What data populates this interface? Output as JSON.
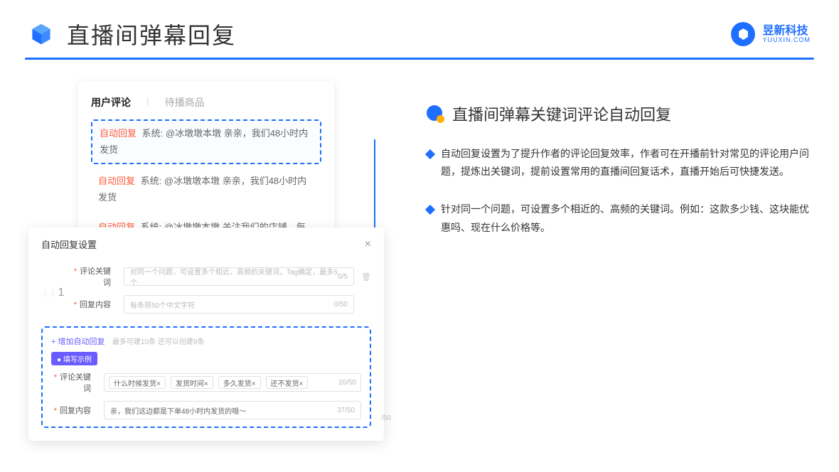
{
  "header": {
    "title": "直播间弹幕回复",
    "brand_name": "昱新科技",
    "brand_sub": "YUUXIN.COM"
  },
  "comments": {
    "tab_active": "用户评论",
    "tab_inactive": "待播商品",
    "rows": [
      {
        "tag": "自动回复",
        "sys": "系统:",
        "text": "@冰墩墩本墩 亲亲，我们48小时内发货"
      },
      {
        "tag": "自动回复",
        "sys": "系统:",
        "text": "@冰墩墩本墩 亲亲，我们48小时内发货"
      },
      {
        "tag": "自动回复",
        "sys": "系统:",
        "text": "@冰墩墩本墩 关注我们的店铺，每日都有热门推荐哟～"
      }
    ]
  },
  "settings": {
    "title": "自动回复设置",
    "index": "1",
    "kw_label": "评论关键词",
    "kw_placeholder": "对同一个问题，可设置多个相近、高频的关键词，Tag确定，最多5个",
    "kw_counter": "0/5",
    "reply_label": "回复内容",
    "reply_placeholder": "每条限50个中文字符",
    "reply_counter": "0/50",
    "add_label": "+ 增加自动回复",
    "add_hint": "最多可建10条 还可以创建9条",
    "example_badge": "● 填写示例",
    "eg_kw_label": "评论关键词",
    "eg_tags": [
      "什么时候发货×",
      "发货时间×",
      "多久发货×",
      "还不发货×"
    ],
    "eg_kw_counter": "20/50",
    "eg_reply_label": "回复内容",
    "eg_reply_text": "亲，我们这边都是下单48小时内发货的哦～",
    "eg_reply_counter": "37/50",
    "side_counter": "/50"
  },
  "feature": {
    "title": "直播间弹幕关键词评论自动回复",
    "bullets": [
      "自动回复设置为了提升作者的评论回复效率，作者可在开播前针对常见的评论用户问题，提炼出关键词，提前设置常用的直播间回复话术，直播开始后可快捷发送。",
      "针对同一个问题，可设置多个相近的、高频的关键词。例如：这款多少钱、这块能优惠吗、现在什么价格等。"
    ]
  }
}
